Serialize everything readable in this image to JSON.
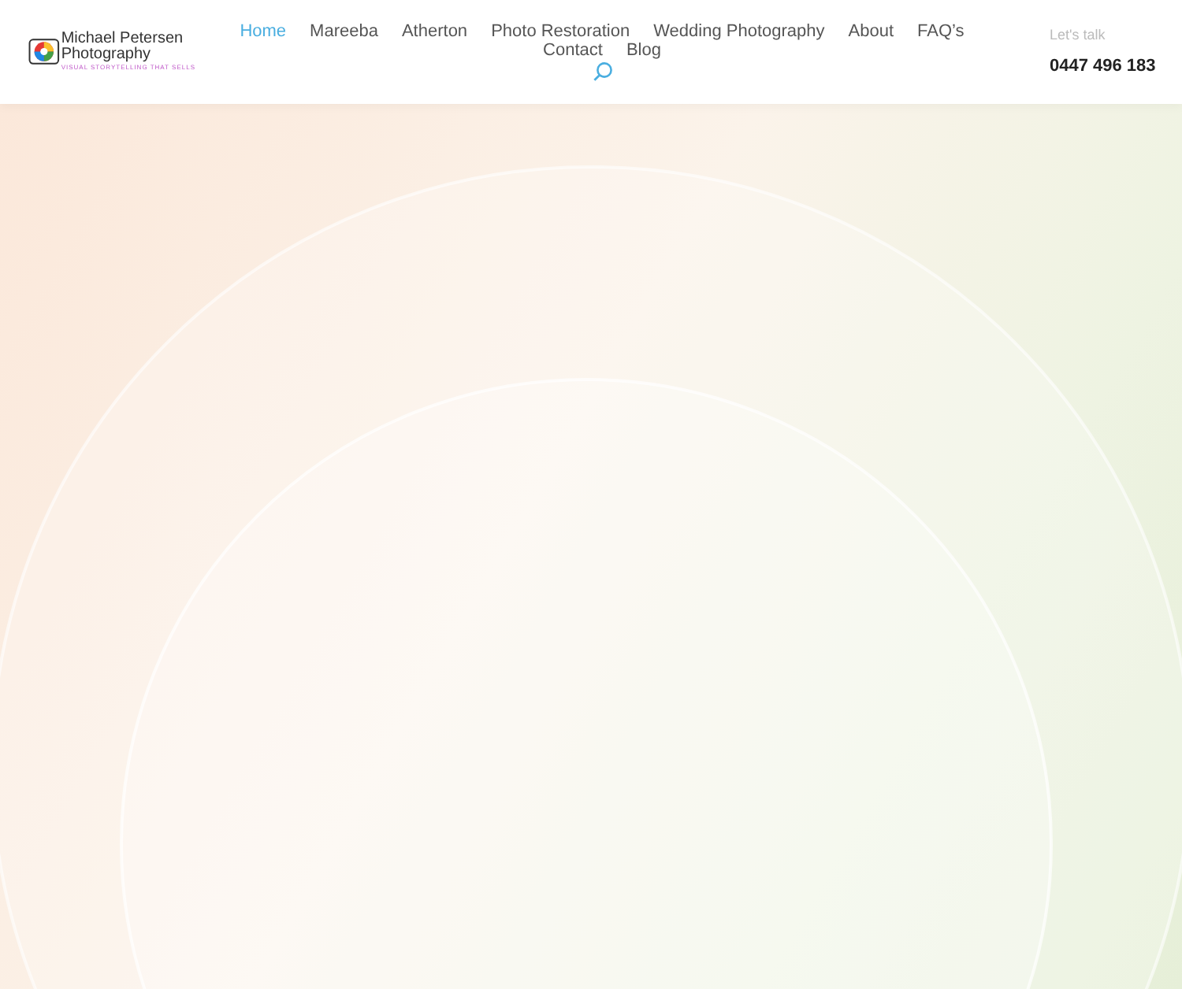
{
  "logo": {
    "name_line_1": "Michael Petersen",
    "name_line_2": "Photography",
    "tagline": "VISUAL STORYTELLING THAT SELLS"
  },
  "nav": [
    {
      "label": "Home",
      "selected": true
    },
    {
      "label": "Mareeba",
      "selected": false
    },
    {
      "label": "Atherton",
      "selected": false
    },
    {
      "label": "Photo Restoration",
      "selected": false
    },
    {
      "label": "Wedding Photography",
      "selected": false
    },
    {
      "label": "About",
      "selected": false
    },
    {
      "label": "FAQ’s",
      "selected": false
    },
    {
      "label": "Contact",
      "selected": false
    },
    {
      "label": "Blog",
      "selected": false
    }
  ],
  "contact": {
    "label": "Let's talk",
    "phone": "0447 496 183"
  }
}
